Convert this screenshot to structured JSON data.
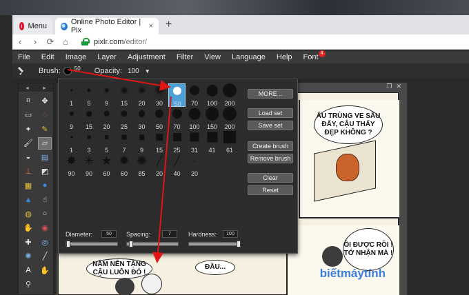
{
  "browser": {
    "menu_tab_label": "Menu",
    "active_tab_title": "Online Photo Editor | Pix",
    "tab_close": "×",
    "new_tab": "+",
    "url_host": "pixlr.com",
    "url_path": "/editor/",
    "back": "‹",
    "forward": "›",
    "reload": "⟳",
    "home": "⌂"
  },
  "menubar": {
    "items": [
      "File",
      "Edit",
      "Image",
      "Layer",
      "Adjustment",
      "Filter",
      "View",
      "Language",
      "Help",
      "Font"
    ],
    "font_badge": "4"
  },
  "options": {
    "brush_label": "Brush:",
    "brush_size": "50",
    "opacity_label": "Opacity:",
    "opacity_value": "100",
    "opacity_caret": "▼"
  },
  "tools": {
    "head_left": "◂",
    "head_right": "▸",
    "items": [
      "crop-icon",
      "move-icon",
      "marquee-icon",
      "lasso-icon",
      "wand-icon",
      "pencil-icon",
      "brush-icon",
      "eraser-icon",
      "bucket-icon",
      "gradient-icon",
      "stamp-icon",
      "replace-icon",
      "drawing-icon",
      "blur-icon",
      "sharpen-icon",
      "smudge-icon",
      "sponge-icon",
      "dodge-icon",
      "burn-icon",
      "redeye-icon",
      "spot-heal-icon",
      "bloat-icon",
      "pinch-icon",
      "colorpicker-icon",
      "type-icon",
      "hand-icon",
      "zoom-icon"
    ]
  },
  "canvas": {
    "window_buttons": [
      "❐",
      "✕"
    ],
    "bubble_top_right": "ẤU TRÙNG VE SẦU ĐẤY, CẬU THẤY ĐẸP KHÔNG ?",
    "bubble_mid_right": "ỒI ĐƯỢC RỒI ! TỚ NHẬN MÀ !",
    "bubble_bottom_left": "NĂM NÊN TẶNG CẬU LUÔN ĐÓ !",
    "bubble_bottom_mid": "ĐẦU...",
    "watermark": "biếtmáytính"
  },
  "brush_popup": {
    "rows": [
      {
        "kind": "soft",
        "labels": [
          "1",
          "5",
          "9",
          "15",
          "20",
          "30",
          "50",
          "70",
          "100",
          "200"
        ]
      },
      {
        "kind": "hard",
        "labels": [
          "9",
          "15",
          "20",
          "25",
          "30",
          "50",
          "70",
          "100",
          "150",
          "200"
        ]
      },
      {
        "kind": "square",
        "labels": [
          "1",
          "3",
          "5",
          "7",
          "9",
          "15",
          "25",
          "31",
          "41",
          "61"
        ]
      },
      {
        "kind": "special",
        "labels": [
          "90",
          "90",
          "60",
          "60",
          "85",
          "20",
          "40",
          "20"
        ]
      }
    ],
    "selected": "50",
    "buttons": [
      "MORE ..",
      "Load set",
      "Save set",
      "Create brush",
      "Remove brush",
      "Clear",
      "Reset"
    ],
    "diameter_label": "Diameter:",
    "diameter_value": "50",
    "spacing_label": "Spacing:",
    "spacing_value": "7",
    "hardness_label": "Hardness:",
    "hardness_value": "100",
    "diameter_fraction": 0.02,
    "spacing_fraction": 0.05,
    "hardness_fraction": 1.0
  },
  "colors": {
    "annotation": "#e01515",
    "selection": "#4ea1d6",
    "app_bg": "#3b3b3b"
  }
}
